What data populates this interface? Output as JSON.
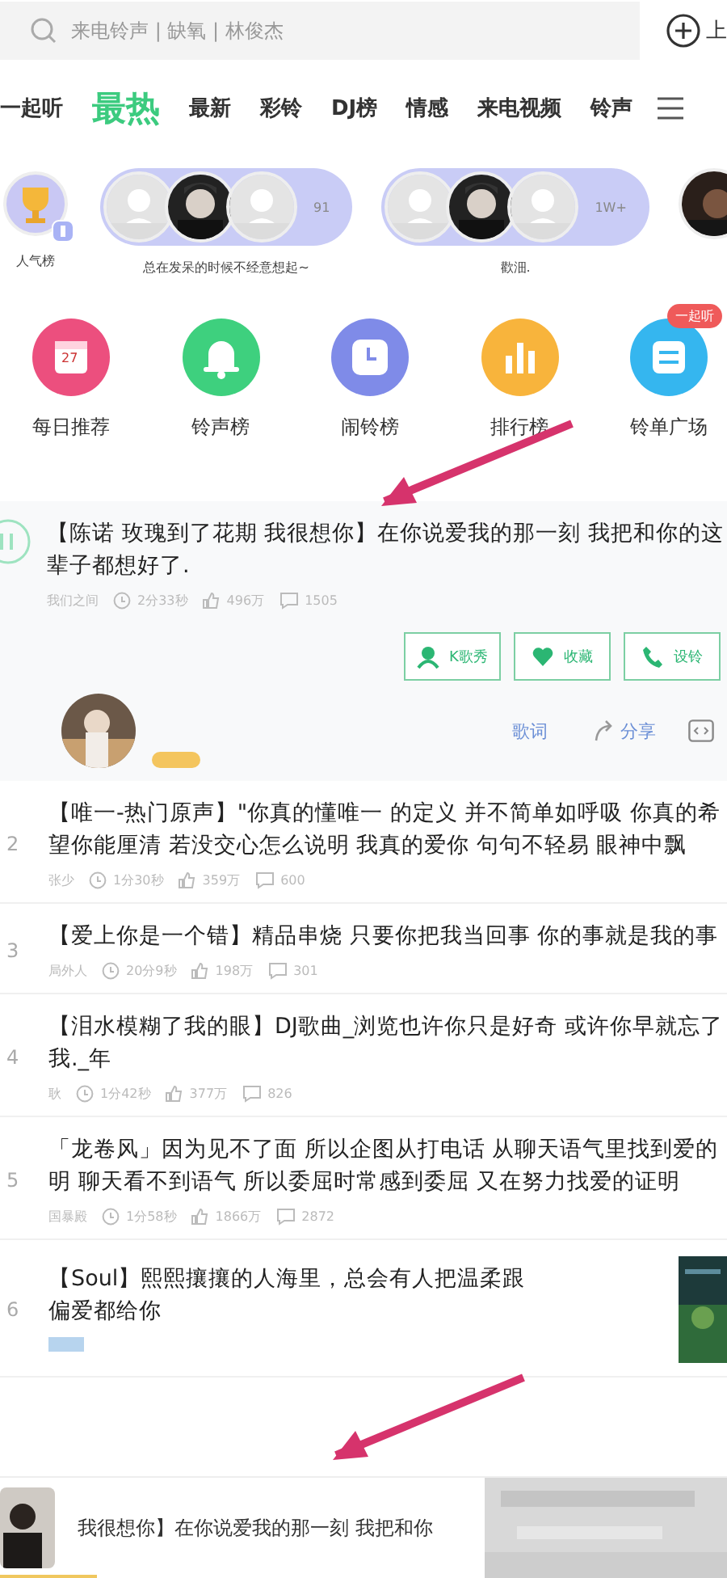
{
  "search": {
    "placeholder": "来电铃声 | 缺氧 | 林俊杰"
  },
  "upload_button": {
    "label": "上"
  },
  "tabs": [
    {
      "label": "一起听",
      "selected": false
    },
    {
      "label": "最热",
      "selected": true
    },
    {
      "label": "最新",
      "selected": false
    },
    {
      "label": "彩铃",
      "selected": false
    },
    {
      "label": "DJ榜",
      "selected": false
    },
    {
      "label": "情感",
      "selected": false
    },
    {
      "label": "来电视频",
      "selected": false
    },
    {
      "label": "铃声",
      "selected": false
    }
  ],
  "rank_circles": [
    {
      "kind": "trophy",
      "caption": "人气榜"
    },
    {
      "kind": "group",
      "count": "91",
      "caption": "总在发呆的时候不经意想起~"
    },
    {
      "kind": "group",
      "count": "1W+",
      "caption": "歡沺."
    },
    {
      "kind": "single"
    }
  ],
  "categories": [
    {
      "label": "每日推荐",
      "color": "#ec4f7e",
      "kind": "calendar",
      "icon_text": "27"
    },
    {
      "label": "铃声榜",
      "color": "#3ed07e",
      "kind": "bell"
    },
    {
      "label": "闹铃榜",
      "color": "#7f8be8",
      "kind": "clock"
    },
    {
      "label": "排行榜",
      "color": "#f8b43c",
      "kind": "bars"
    },
    {
      "label": "铃单广场",
      "color": "#35b6ef",
      "kind": "list",
      "badge": "一起听"
    }
  ],
  "featured": {
    "playing": true,
    "lines": [
      "【陈诺 玫瑰到了花期 我很想你】在你说爱我的那一刻 我把和你的这",
      "辈子都想好了."
    ],
    "author": "我们之间",
    "duration": "2分33秒",
    "plays": "496万",
    "comments": "1505",
    "buttons": [
      {
        "kind": "sing",
        "label": "K歌秀"
      },
      {
        "kind": "heart",
        "label": "收藏"
      },
      {
        "kind": "phone",
        "label": "设铃"
      }
    ],
    "actions": [
      {
        "kind": "lyrics",
        "label": "歌词"
      },
      {
        "kind": "share",
        "label": "分享"
      }
    ]
  },
  "songs": [
    {
      "kind": "meta",
      "rank": "2",
      "lines": [
        "【唯一-热门原声】\"你真的懂唯一 的定义 并不简单如呼吸 你真的希",
        "望你能厘清 若没交心怎么说明 我真的爱你 句句不轻易 眼神中飘"
      ],
      "author": "张少",
      "duration": "1分30秒",
      "plays": "359万",
      "comments": "600"
    },
    {
      "kind": "meta",
      "rank": "3",
      "lines": [
        "【爱上你是一个错】精品串烧 只要你把我当回事 你的事就是我的事"
      ],
      "author": "局外人",
      "duration": "20分9秒",
      "plays": "198万",
      "comments": "301"
    },
    {
      "kind": "meta",
      "rank": "4",
      "lines": [
        "【泪水模糊了我的眼】DJ歌曲_浏览也许你只是好奇 或许你早就忘了",
        "我._年"
      ],
      "author": "耿",
      "duration": "1分42秒",
      "plays": "377万",
      "comments": "826"
    },
    {
      "kind": "meta",
      "rank": "5",
      "lines": [
        "「龙卷风」因为见不了面 所以企图从打电话 从聊天语气里找到爱的",
        "明 聊天看不到语气 所以委屈时常感到委屈 又在努力找爱的证明"
      ],
      "author": "国暴殿",
      "duration": "1分58秒",
      "plays": "1866万",
      "comments": "2872"
    },
    {
      "kind": "tag",
      "rank": "6",
      "lines": [
        "【Soul】熙熙攘攘的人海里，总会有人把温柔跟",
        "偏爱都给你"
      ]
    }
  ],
  "mini_player": {
    "title": "我很想你】在你说爱我的那一刻 我把和你"
  }
}
